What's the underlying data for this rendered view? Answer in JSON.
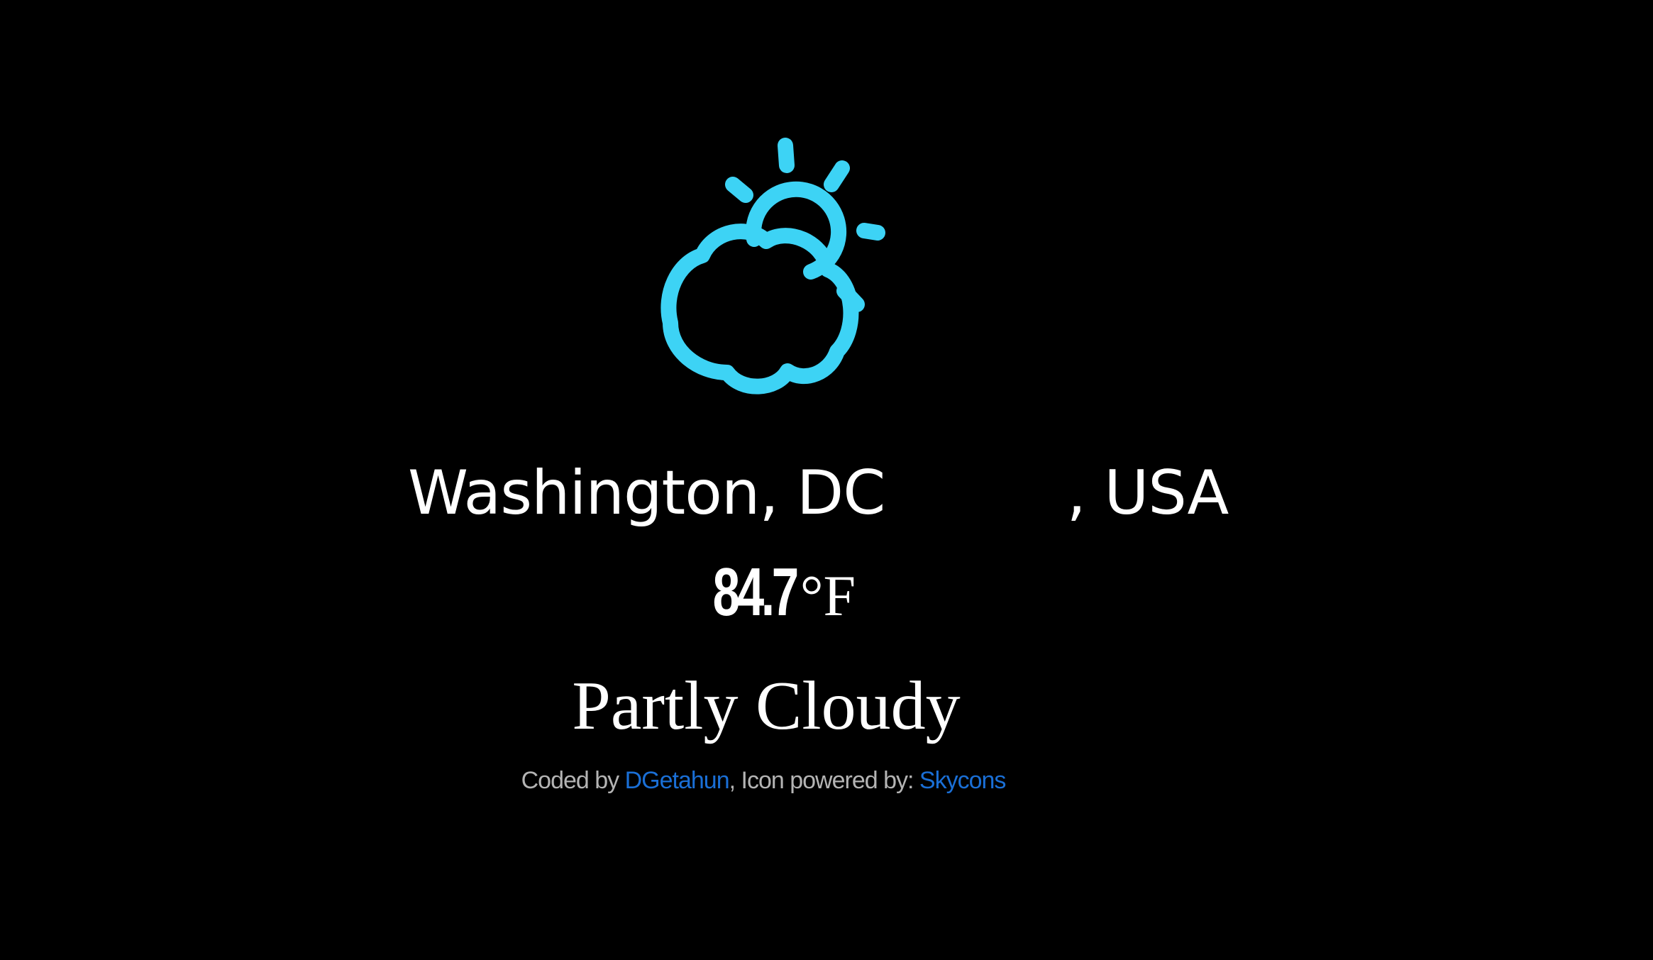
{
  "weather": {
    "icon": "partly-cloudy-day-icon",
    "icon_color": "#3dd3f5",
    "location_city": "Washington, DC ",
    "location_country": ", USA",
    "temperature_value": "84.7",
    "temperature_unit": "°F",
    "condition": "Partly Cloudy"
  },
  "credits": {
    "coded_by_label": "Coded by ",
    "author_link": "DGetahun",
    "icon_label": ", Icon powered by: ",
    "icon_link": "Skycons",
    "link_color": "#1a6fd6"
  }
}
